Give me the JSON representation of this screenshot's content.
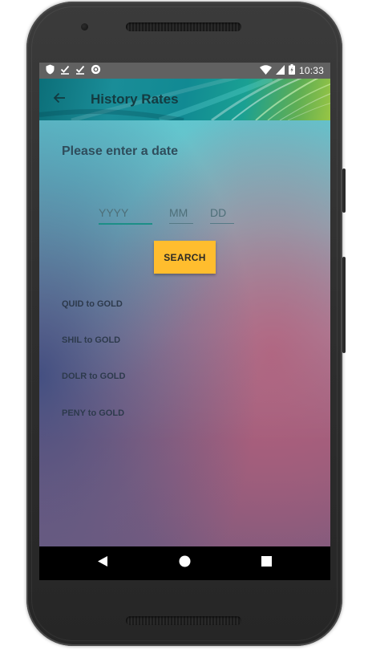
{
  "colors": {
    "status_bar": "#616161",
    "search_button": "#ffbd2e",
    "accent_underline": "#1c8f87",
    "nav_bar": "#000000"
  },
  "status_bar": {
    "left_icons": [
      "shield-icon",
      "download-done-icon",
      "download-done-icon",
      "sync-icon"
    ],
    "right_icons": [
      "wifi-icon",
      "cell-signal-icon",
      "battery-icon"
    ],
    "time": "10:33"
  },
  "app_bar": {
    "back_icon": "arrow-back-icon",
    "title": "History Rates"
  },
  "form": {
    "prompt": "Please enter a date",
    "year_placeholder": "YYYY",
    "month_placeholder": "MM",
    "day_placeholder": "DD",
    "year_value": "",
    "month_value": "",
    "day_value": "",
    "search_label": "SEARCH"
  },
  "rates": [
    {
      "label": "QUID to GOLD"
    },
    {
      "label": "SHIL to GOLD"
    },
    {
      "label": "DOLR to GOLD"
    },
    {
      "label": "PENY to GOLD"
    }
  ],
  "nav_bar": {
    "buttons": [
      "back-triangle-icon",
      "home-circle-icon",
      "recents-square-icon"
    ]
  }
}
